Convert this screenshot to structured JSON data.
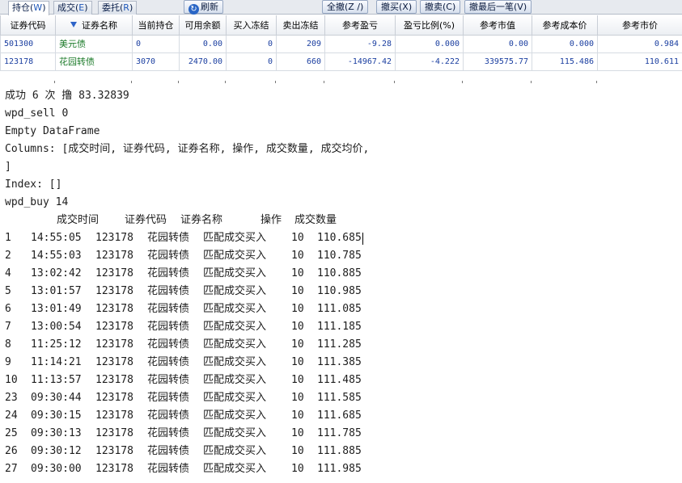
{
  "toolbar": {
    "tabs": [
      {
        "label": "持仓(",
        "hotkey": "W",
        "tail": ")"
      },
      {
        "label": "成交(",
        "hotkey": "E",
        "tail": ")"
      },
      {
        "label": "委托(",
        "hotkey": "R",
        "tail": ")"
      }
    ],
    "refresh_label": "刷新",
    "buttons": [
      "全撤(Z /)",
      "撤买(X)",
      "撤卖(C)",
      "撤最后一笔(V)"
    ]
  },
  "holdings": {
    "columns": [
      "证券代码",
      "证券名称",
      "当前持仓",
      "可用余额",
      "买入冻结",
      "卖出冻结",
      "参考盈亏",
      "盈亏比例(%)",
      "参考市值",
      "参考成本价",
      "参考市价"
    ],
    "rows": [
      [
        "501300",
        "美元债",
        "0",
        "0.00",
        "0",
        "209",
        "-9.28",
        "0.000",
        "0.00",
        "0.000",
        "0.984"
      ],
      [
        "123178",
        "花园转债",
        "3070",
        "2470.00",
        "0",
        "660",
        "-14967.42",
        "-4.222",
        "339575.77",
        "115.486",
        "110.611"
      ]
    ]
  },
  "console": {
    "lines": [
      "成功 6 次 撸 83.32839",
      "wpd_sell 0",
      "Empty DataFrame",
      "Columns: [成交时间, 证券代码, 证券名称, 操作, 成交数量, 成交均价,",
      "]",
      "Index: []",
      "wpd_buy 14"
    ],
    "header": [
      "成交时间",
      "证券代码",
      "证券名称",
      "操作",
      "成交数量"
    ],
    "rows": [
      [
        "1",
        "14:55:05",
        "123178",
        "花园转债",
        "匹配成交买入",
        "10",
        "110.685"
      ],
      [
        "2",
        "14:55:03",
        "123178",
        "花园转债",
        "匹配成交买入",
        "10",
        "110.785"
      ],
      [
        "4",
        "13:02:42",
        "123178",
        "花园转债",
        "匹配成交买入",
        "10",
        "110.885"
      ],
      [
        "5",
        "13:01:57",
        "123178",
        "花园转债",
        "匹配成交买入",
        "10",
        "110.985"
      ],
      [
        "6",
        "13:01:49",
        "123178",
        "花园转债",
        "匹配成交买入",
        "10",
        "111.085"
      ],
      [
        "7",
        "13:00:54",
        "123178",
        "花园转债",
        "匹配成交买入",
        "10",
        "111.185"
      ],
      [
        "8",
        "11:25:12",
        "123178",
        "花园转债",
        "匹配成交买入",
        "10",
        "111.285"
      ],
      [
        "9",
        "11:14:21",
        "123178",
        "花园转债",
        "匹配成交买入",
        "10",
        "111.385"
      ],
      [
        "10",
        "11:13:57",
        "123178",
        "花园转债",
        "匹配成交买入",
        "10",
        "111.485"
      ],
      [
        "23",
        "09:30:44",
        "123178",
        "花园转债",
        "匹配成交买入",
        "10",
        "111.585"
      ],
      [
        "24",
        "09:30:15",
        "123178",
        "花园转债",
        "匹配成交买入",
        "10",
        "111.685"
      ],
      [
        "25",
        "09:30:13",
        "123178",
        "花园转债",
        "匹配成交买入",
        "10",
        "111.785"
      ],
      [
        "26",
        "09:30:12",
        "123178",
        "花园转债",
        "匹配成交买入",
        "10",
        "111.885"
      ],
      [
        "27",
        "09:30:00",
        "123178",
        "花园转债",
        "匹配成交买入",
        "10",
        "111.985"
      ]
    ]
  }
}
